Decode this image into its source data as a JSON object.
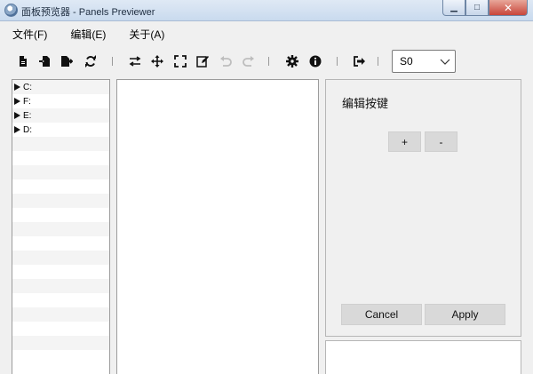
{
  "window": {
    "title": "面板预览器 - Panels Previewer",
    "minimize_glyph": "▁",
    "maximize_glyph": "□",
    "close_glyph": "✕"
  },
  "menu": {
    "file": "文件(F)",
    "edit": "编辑(E)",
    "about": "关于(A)"
  },
  "toolbar": {
    "icons": [
      "new-file-icon",
      "import-icon",
      "export-icon",
      "refresh-icon",
      "swap-icon",
      "move-icon",
      "fullscreen-icon",
      "edit-icon",
      "undo-icon",
      "redo-icon",
      "settings-icon",
      "info-icon",
      "exit-icon"
    ],
    "disabled": [
      "undo-icon",
      "redo-icon"
    ],
    "combo_value": "S0"
  },
  "tree": {
    "drives": [
      "C:",
      "F:",
      "E:",
      "D:"
    ]
  },
  "key_editor": {
    "title": "编辑按键",
    "plus_label": "+",
    "minus_label": "-",
    "cancel_label": "Cancel",
    "apply_label": "Apply"
  }
}
